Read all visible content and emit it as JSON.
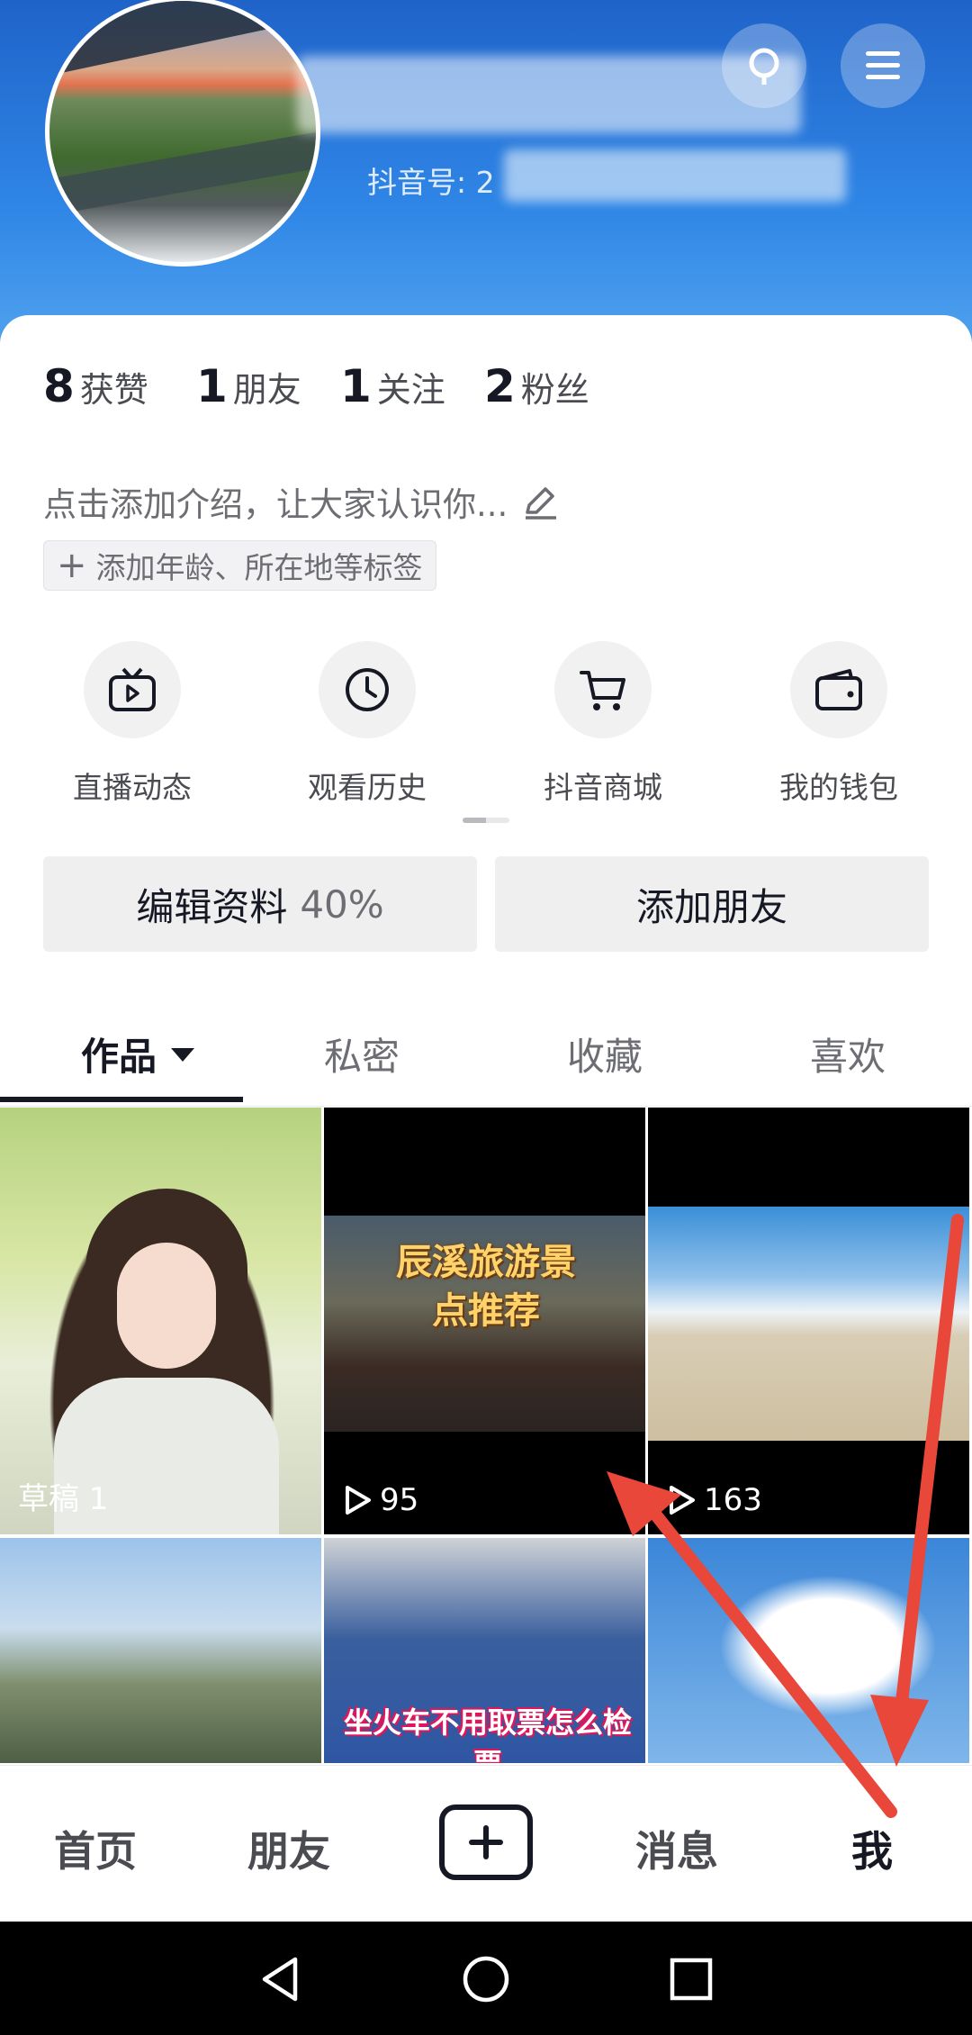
{
  "profile": {
    "douyin_id_label": "抖音号: 2"
  },
  "stats": [
    {
      "value": "8",
      "label": "获赞"
    },
    {
      "value": "1",
      "label": "朋友"
    },
    {
      "value": "1",
      "label": "关注"
    },
    {
      "value": "2",
      "label": "粉丝"
    }
  ],
  "bio": {
    "placeholder": "点击添加介绍，让大家认识你...",
    "tag_button": "添加年龄、所在地等标签"
  },
  "shortcuts": [
    {
      "label": "直播动态",
      "icon": "tv-play-icon"
    },
    {
      "label": "观看历史",
      "icon": "clock-icon"
    },
    {
      "label": "抖音商城",
      "icon": "cart-icon"
    },
    {
      "label": "我的钱包",
      "icon": "wallet-icon"
    }
  ],
  "actions": {
    "edit_profile": "编辑资料",
    "edit_profile_pct": "40%",
    "add_friend": "添加朋友"
  },
  "tabs": [
    "作品",
    "私密",
    "收藏",
    "喜欢"
  ],
  "grid": {
    "tile1_label": "草稿 1",
    "tile2_plays": "95",
    "tile2_caption_line1": "辰溪旅游景",
    "tile2_caption_line2": "点推荐",
    "tile3_plays": "163",
    "tile5_caption": "坐火车不用取票怎么检票"
  },
  "bottom_nav": {
    "home": "首页",
    "friends": "朋友",
    "messages": "消息",
    "me": "我"
  },
  "colors": {
    "header_blue": "#2f86e6",
    "annotation_red": "#e8473a",
    "text_primary": "#161823"
  }
}
